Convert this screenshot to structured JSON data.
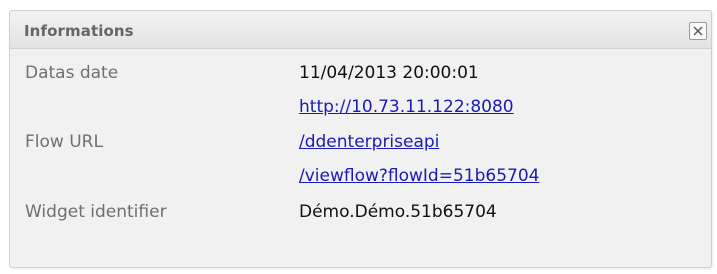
{
  "dialog": {
    "title": "Informations",
    "close_icon": "close-icon"
  },
  "fields": {
    "datas_date": {
      "label": "Datas date",
      "value": "11/04/2013 20:00:01"
    },
    "flow_url": {
      "label": "Flow URL",
      "lines": [
        "http://10.73.11.122:8080",
        "/ddenterpriseapi",
        "/viewflow?flowId=51b65704"
      ]
    },
    "widget_identifier": {
      "label": "Widget identifier",
      "value": "Démo.Démo.51b65704"
    }
  },
  "colors": {
    "link": "#1a1ab8",
    "label": "#707070",
    "panel": "#f1f1f1"
  }
}
